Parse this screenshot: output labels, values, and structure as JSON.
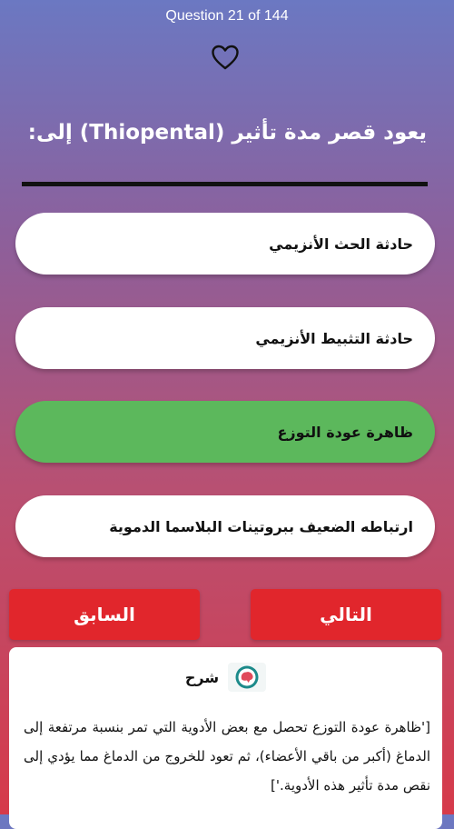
{
  "header": {
    "counter": "Question 21 of 144",
    "favorite_icon": "heart-outline-icon"
  },
  "question": {
    "text": "يعود قصر مدة تأثير (Thiopental) إلى:"
  },
  "options": [
    {
      "label": "حادثة الحث الأنزيمي",
      "state": "default"
    },
    {
      "label": "حادثة التثبيط الأنزيمي",
      "state": "default"
    },
    {
      "label": "ظاهرة عودة التوزع",
      "state": "correct"
    },
    {
      "label": "ارتباطه الضعيف ببروتينات البلاسما الدموية",
      "state": "default"
    }
  ],
  "nav": {
    "next_label": "التالي",
    "prev_label": "السابق"
  },
  "explanation": {
    "title": "شرح",
    "icon": "brain-logo-icon",
    "text": "['ظاهرة عودة التوزع تحصل مع بعض الأدوية التي تمر بنسبة مرتفعة إلى الدماغ (أكبر من باقي الأعضاء)، ثم تعود للخروج من   الدماغ مما يؤدي إلى نقص مدة تأثير هذه الأدوية.']"
  },
  "colors": {
    "correct": "#5cb85c",
    "button_red": "#e1262c",
    "gradient_top": "#6b78c2",
    "gradient_bottom": "#d63a4a"
  }
}
